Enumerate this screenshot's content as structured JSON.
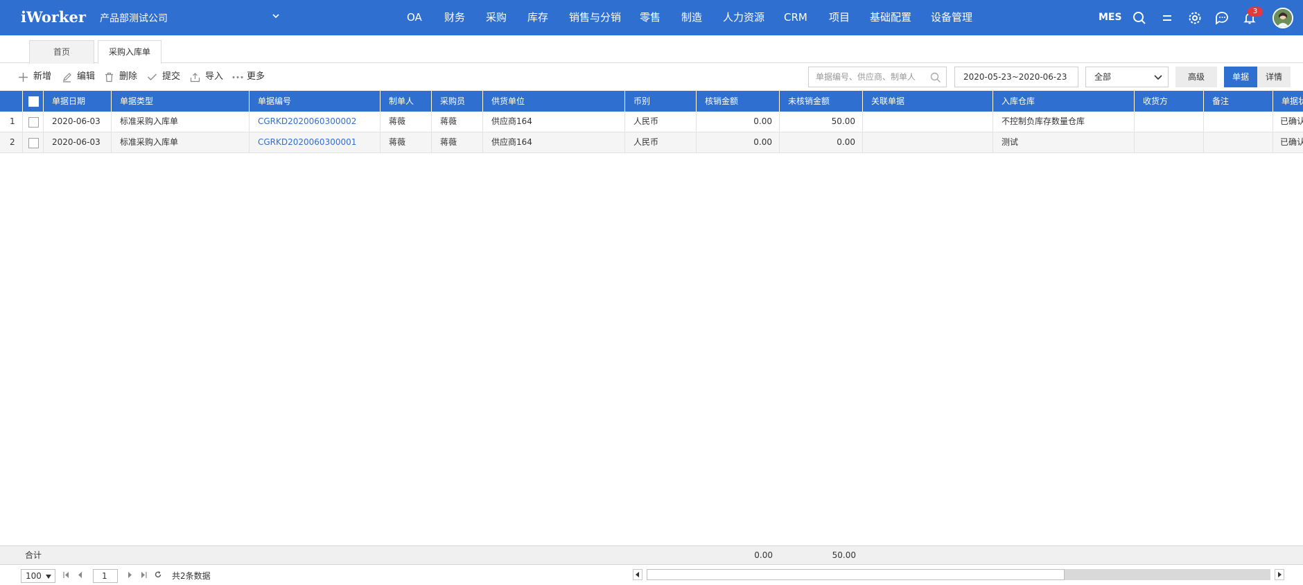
{
  "header": {
    "logo": "iWorker",
    "company": "产品部测试公司",
    "nav": [
      "OA",
      "财务",
      "采购",
      "库存",
      "销售与分销",
      "零售",
      "制造",
      "人力资源",
      "CRM",
      "项目",
      "基础配置",
      "设备管理"
    ],
    "mes": "MES",
    "notification_count": "3",
    "brand_color": "#2f6fcf"
  },
  "tabs": {
    "home": "首页",
    "active": "采购入库单"
  },
  "toolbar": {
    "new": "新增",
    "edit": "编辑",
    "delete": "删除",
    "submit": "提交",
    "import": "导入",
    "more": "更多",
    "search_placeholder": "单据编号、供应商、制单人",
    "date_range": "2020-05-23~2020-06-23",
    "status_filter": "全部",
    "advanced": "高级",
    "view_doc": "单据",
    "view_detail": "详情"
  },
  "table": {
    "columns": [
      "单据日期",
      "单据类型",
      "单据编号",
      "制单人",
      "采购员",
      "供货单位",
      "币别",
      "核销金额",
      "未核销金额",
      "关联单据",
      "入库仓库",
      "收货方",
      "备注",
      "单据状态"
    ],
    "rows": [
      {
        "no": "1",
        "date": "2020-06-03",
        "type": "标准采购入库单",
        "code": "CGRKD2020060300002",
        "maker": "蒋薇",
        "buyer": "蒋薇",
        "supplier": "供应商164",
        "currency": "人民币",
        "written_off": "0.00",
        "unwritten_off": "50.00",
        "related": "",
        "warehouse": "不控制负库存数量仓库",
        "receiver": "",
        "remark": "",
        "status": "已确认"
      },
      {
        "no": "2",
        "date": "2020-06-03",
        "type": "标准采购入库单",
        "code": "CGRKD2020060300001",
        "maker": "蒋薇",
        "buyer": "蒋薇",
        "supplier": "供应商164",
        "currency": "人民币",
        "written_off": "0.00",
        "unwritten_off": "0.00",
        "related": "",
        "warehouse": "测试",
        "receiver": "",
        "remark": "",
        "status": "已确认"
      }
    ]
  },
  "summary": {
    "label": "合计",
    "written_off_total": "0.00",
    "unwritten_off_total": "50.00"
  },
  "pager": {
    "page_size": "100",
    "current_page": "1",
    "total_text": "共2条数据",
    "scroll_fraction": 0.67
  }
}
